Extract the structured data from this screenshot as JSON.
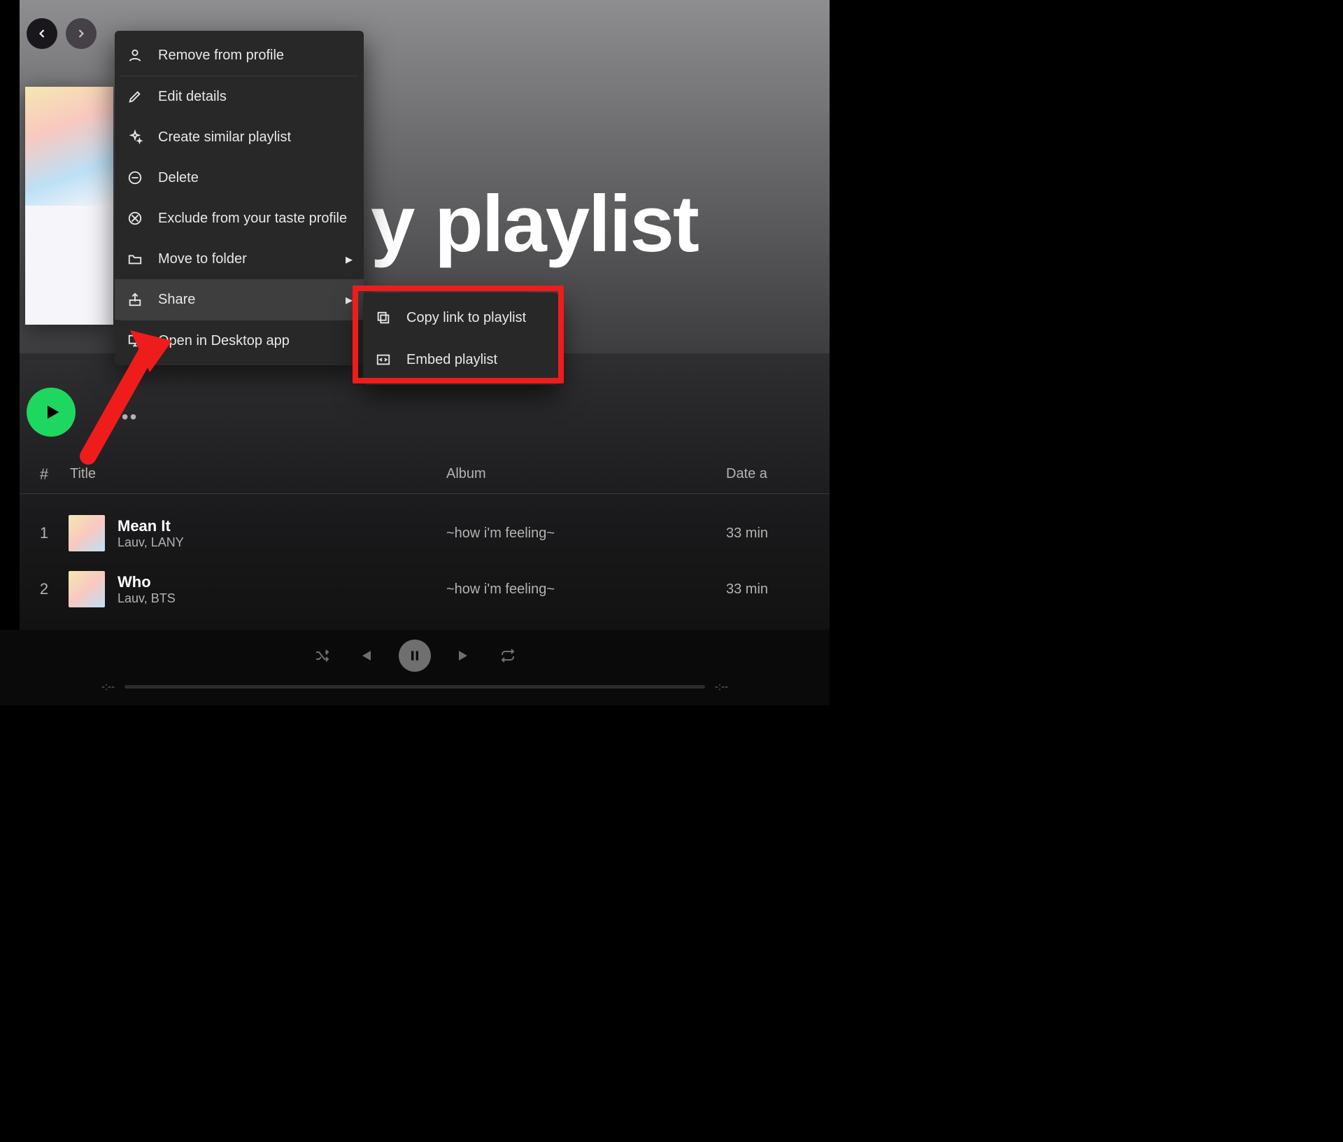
{
  "nav": {
    "back_enabled": true,
    "forward_enabled": false
  },
  "playlist": {
    "title_visible": "y playlist"
  },
  "context_menu": {
    "items": [
      {
        "label": "Remove from profile",
        "icon": "profile-remove-icon"
      },
      {
        "label": "Edit details",
        "icon": "edit-icon"
      },
      {
        "label": "Create similar playlist",
        "icon": "sparkle-icon"
      },
      {
        "label": "Delete",
        "icon": "delete-icon"
      },
      {
        "label": "Exclude from your taste profile",
        "icon": "exclude-icon"
      },
      {
        "label": "Move to folder",
        "icon": "folder-icon",
        "submenu": true
      },
      {
        "label": "Share",
        "icon": "share-icon",
        "submenu": true,
        "highlighted": true
      },
      {
        "label": "Open in Desktop app",
        "icon": "desktop-icon"
      }
    ],
    "share_submenu": [
      {
        "label": "Copy link to playlist",
        "icon": "copy-link-icon"
      },
      {
        "label": "Embed playlist",
        "icon": "embed-icon"
      }
    ]
  },
  "table": {
    "columns": {
      "num": "#",
      "title": "Title",
      "album": "Album",
      "date": "Date a"
    },
    "rows": [
      {
        "num": "1",
        "name": "Mean It",
        "artist": "Lauv, LANY",
        "album": "~how i'm feeling~",
        "date": "33 min"
      },
      {
        "num": "2",
        "name": "Who",
        "artist": "Lauv, BTS",
        "album": "~how i'm feeling~",
        "date": "33 min"
      }
    ]
  },
  "player": {
    "elapsed": "-:--",
    "remaining": "-:--"
  }
}
